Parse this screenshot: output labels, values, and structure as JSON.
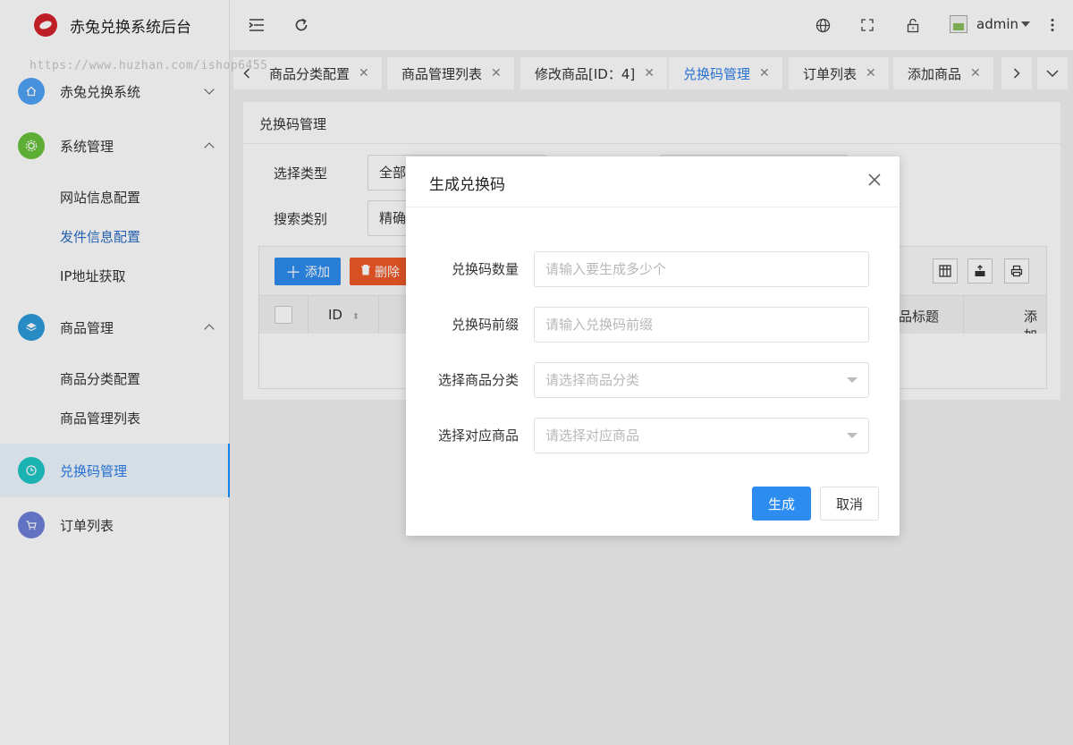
{
  "app": {
    "title": "赤兔兑换系统后台",
    "watermark": "https://www.huzhan.com/ishop6455"
  },
  "sidebar": {
    "groups": [
      {
        "label": "赤兔兑换系统",
        "icon": "home-icon",
        "color": "#4fa3f7"
      },
      {
        "label": "系统管理",
        "icon": "gear-icon",
        "color": "#67c23a"
      },
      {
        "label": "商品管理",
        "icon": "layers-icon",
        "color": "#2d9cdb"
      },
      {
        "label": "兑换码管理",
        "icon": "clock-icon",
        "color": "#1fc7c7"
      },
      {
        "label": "订单列表",
        "icon": "cart-icon",
        "color": "#6c7fd8"
      }
    ],
    "system_sub": [
      "网站信息配置",
      "发件信息配置",
      "IP地址获取"
    ],
    "goods_sub": [
      "商品分类配置",
      "商品管理列表"
    ]
  },
  "topbar": {
    "user": "admin"
  },
  "tabs": [
    {
      "label": "商品分类配置"
    },
    {
      "label": "商品管理列表"
    },
    {
      "label": "修改商品[ID：4]"
    },
    {
      "label": "兑换码管理"
    },
    {
      "label": "订单列表"
    },
    {
      "label": "添加商品"
    }
  ],
  "panel": {
    "title": "兑换码管理",
    "filter_type_label": "选择类型",
    "filter_type_value": "全部",
    "search_type_label": "搜索类别",
    "search_type_value": "精确",
    "add_label": "添加",
    "delete_label": "删除",
    "columns": {
      "id": "ID",
      "goods_title": "品标题",
      "added": "添加"
    }
  },
  "modal": {
    "title": "生成兑换码",
    "count_label": "兑换码数量",
    "count_placeholder": "请输入要生成多少个",
    "prefix_label": "兑换码前缀",
    "prefix_placeholder": "请输入兑换码前缀",
    "category_label": "选择商品分类",
    "category_placeholder": "请选择商品分类",
    "goods_label": "选择对应商品",
    "goods_placeholder": "请选择对应商品",
    "submit_label": "生成",
    "cancel_label": "取消"
  }
}
